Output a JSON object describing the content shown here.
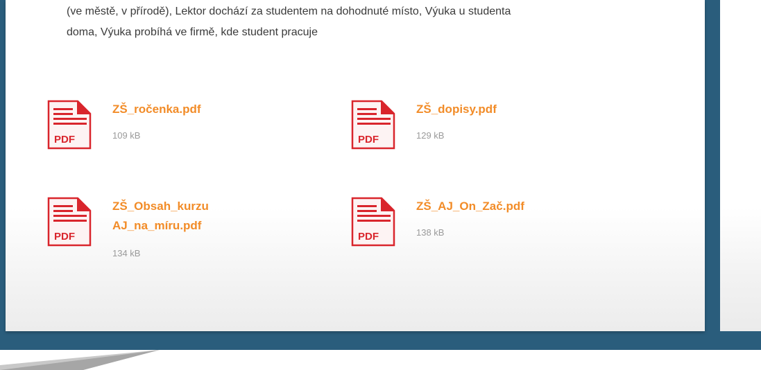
{
  "description": {
    "line1": "(ve městě, v přírodě), Lektor dochází za studentem na dohodnuté místo, Výuka u studenta",
    "line2": "doma, Výuka probíhá ve firmě, kde student pracuje"
  },
  "files": [
    {
      "name_line1": "ZŠ_ročenka.pdf",
      "name_line2": "",
      "size": "109 kB",
      "icon": "pdf-icon",
      "icon_label": "PDF"
    },
    {
      "name_line1": "ZŠ_dopisy.pdf",
      "name_line2": "",
      "size": "129 kB",
      "icon": "pdf-icon",
      "icon_label": "PDF"
    },
    {
      "name_line1": "ZŠ_Obsah_kurzu",
      "name_line2": "AJ_na_míru.pdf",
      "size": "134 kB",
      "icon": "pdf-icon",
      "icon_label": "PDF"
    },
    {
      "name_line1": "ZŠ_AJ_On_Zač.pdf",
      "name_line2": "",
      "size": "138 kB",
      "icon": "pdf-icon",
      "icon_label": "PDF"
    }
  ],
  "colors": {
    "link": "#f28c28",
    "pdf_red": "#d9252c",
    "band": "#2a5d7c",
    "text": "#3a3a3a",
    "muted": "#9a9a9a"
  }
}
